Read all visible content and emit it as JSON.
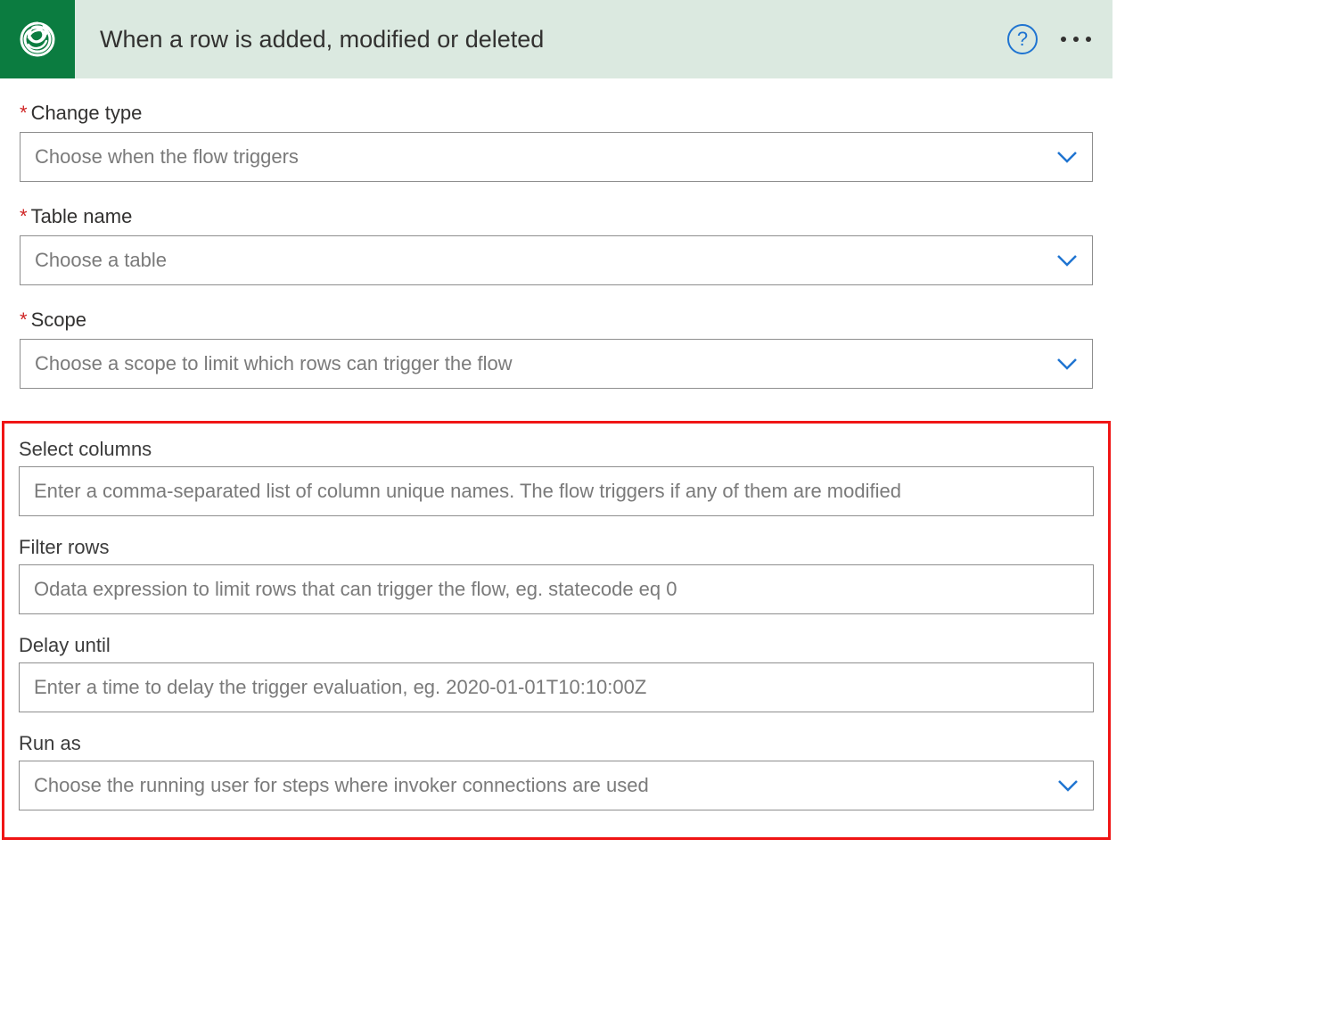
{
  "header": {
    "title": "When a row is added, modified or deleted"
  },
  "fields": {
    "changeType": {
      "label": "Change type",
      "required": true,
      "placeholder": "Choose when the flow triggers"
    },
    "tableName": {
      "label": "Table name",
      "required": true,
      "placeholder": "Choose a table"
    },
    "scope": {
      "label": "Scope",
      "required": true,
      "placeholder": "Choose a scope to limit which rows can trigger the flow"
    },
    "selectColumns": {
      "label": "Select columns",
      "required": false,
      "placeholder": "Enter a comma-separated list of column unique names. The flow triggers if any of them are modified"
    },
    "filterRows": {
      "label": "Filter rows",
      "required": false,
      "placeholder": "Odata expression to limit rows that can trigger the flow, eg. statecode eq 0"
    },
    "delayUntil": {
      "label": "Delay until",
      "required": false,
      "placeholder": "Enter a time to delay the trigger evaluation, eg. 2020-01-01T10:10:00Z"
    },
    "runAs": {
      "label": "Run as",
      "required": false,
      "placeholder": "Choose the running user for steps where invoker connections are used"
    }
  }
}
